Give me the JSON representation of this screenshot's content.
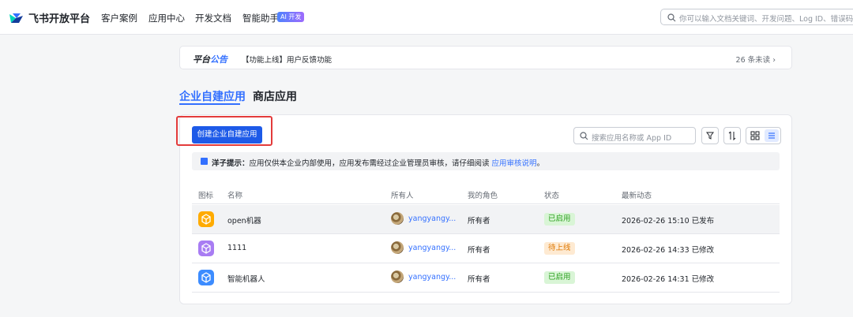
{
  "brand": {
    "name": "飞书开放平台"
  },
  "nav": {
    "items": [
      "客户案例",
      "应用中心",
      "开发文档",
      "智能助手"
    ],
    "ai_badge": "AI 开发",
    "search_placeholder": "你可以输入文档关键词、开发问题、Log ID、错误码"
  },
  "announcement": {
    "title_part1": "平台",
    "title_part2": "公告",
    "text": "【功能上线】用户反馈功能",
    "unread": "26 条未读"
  },
  "tabs": {
    "active": "企业自建应用",
    "inactive": "商店应用"
  },
  "toolbar": {
    "create_label": "创建企业自建应用",
    "search_placeholder": "搜索应用名称或 App ID"
  },
  "tip": {
    "label": "洋子提示：",
    "text": "应用仅供本企业内部使用，应用发布需经过企业管理员审核，请仔细阅读 ",
    "link": "应用审核说明",
    "end": "。"
  },
  "table": {
    "headers": [
      "图标",
      "名称",
      "所有人",
      "我的角色",
      "状态",
      "最新动态"
    ],
    "rows": [
      {
        "name": "open机器",
        "owner": "yangyangy...",
        "role": "所有者",
        "status": "已启用",
        "status_type": "on",
        "activity": "2026-02-26 15:10 已发布",
        "icon_color": "#ffab00"
      },
      {
        "name": "1111",
        "owner": "yangyangy...",
        "role": "所有者",
        "status": "待上线",
        "status_type": "pending",
        "activity": "2026-02-26 14:33 已修改",
        "icon_color": "#a87cf3"
      },
      {
        "name": "智能机器人",
        "owner": "yangyangy...",
        "role": "所有者",
        "status": "已启用",
        "status_type": "on",
        "activity": "2026-02-26 14:31 已修改",
        "icon_color": "#3c8cff"
      }
    ]
  },
  "colors": {
    "accent": "#3370ff",
    "primary_button": "#1d5ae8",
    "highlight_box": "#e33b3b"
  }
}
